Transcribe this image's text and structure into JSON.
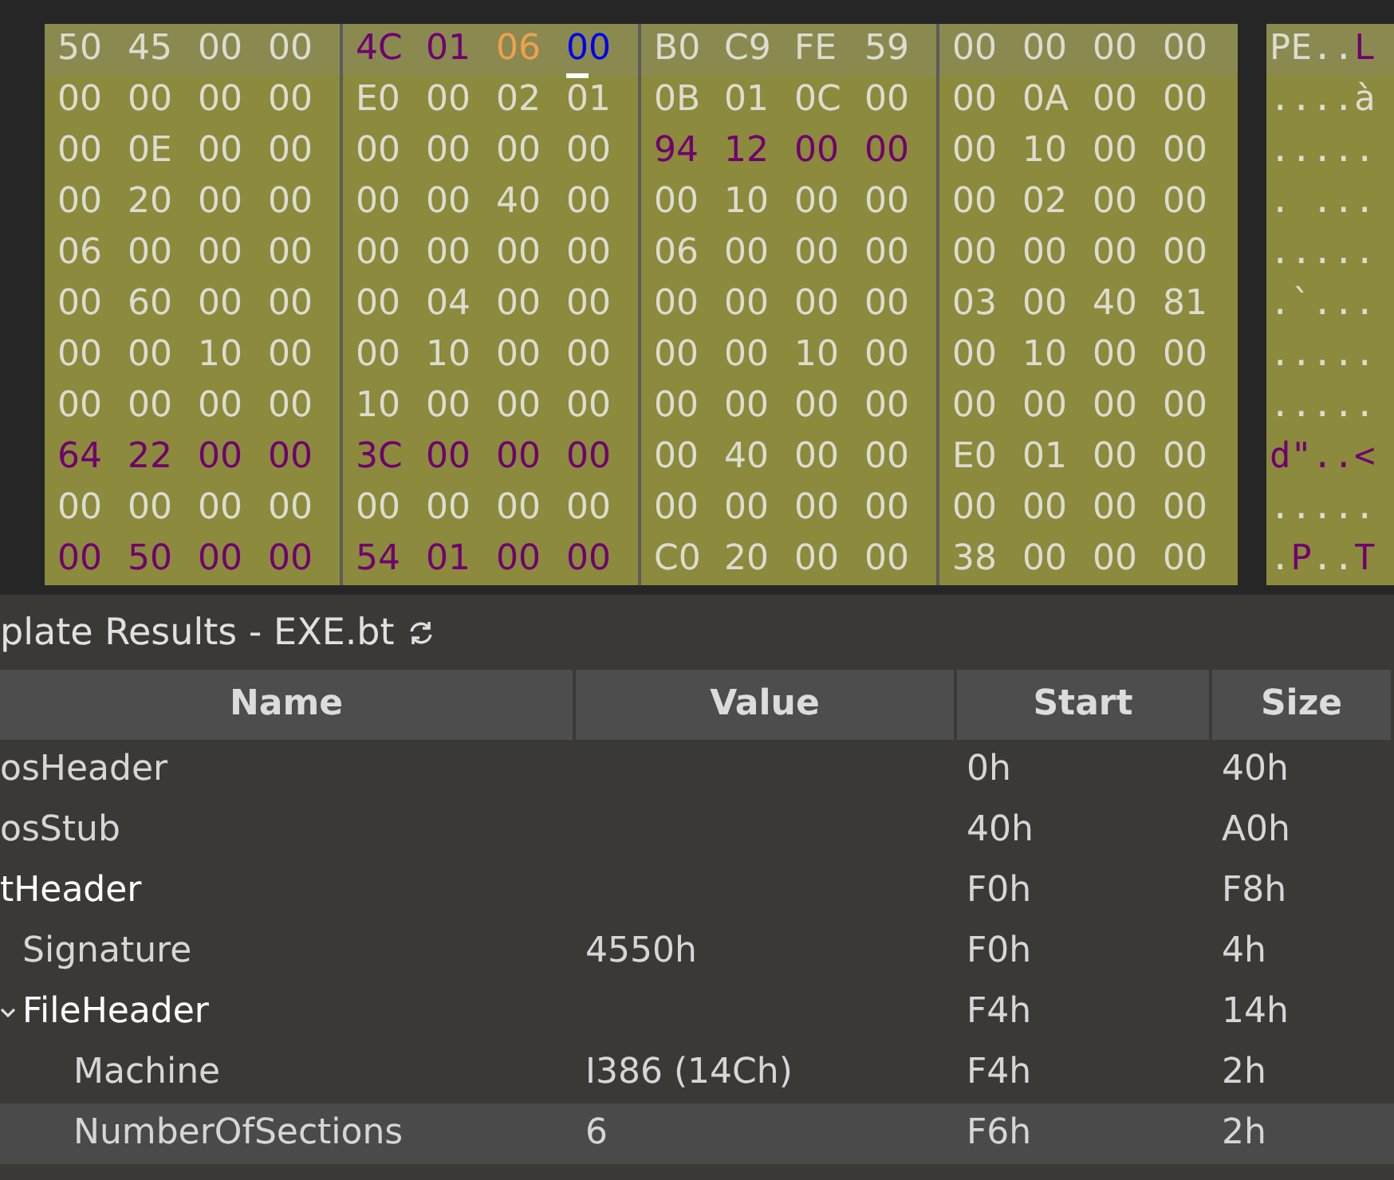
{
  "hex_view": {
    "rows": [
      {
        "selected": true,
        "bytes": [
          "50",
          "45",
          "00",
          "00",
          {
            "text": "4C",
            "color": "#700070"
          },
          {
            "text": "01",
            "color": "#700070"
          },
          {
            "text": "06",
            "color": "#f0a050"
          },
          {
            "text": "00",
            "color": "#0000ee",
            "cursor": true
          },
          "B0",
          "C9",
          "FE",
          "59",
          "00",
          "00",
          "00",
          "00"
        ],
        "ascii": [
          {
            "text": "PE.."
          },
          {
            "text": "L",
            "color": "#700070"
          }
        ]
      },
      {
        "selected": false,
        "bytes": [
          "00",
          "00",
          "00",
          "00",
          "E0",
          "00",
          "02",
          "01",
          "0B",
          "01",
          "0C",
          "00",
          "00",
          "0A",
          "00",
          "00"
        ],
        "ascii": [
          {
            "text": "....à"
          }
        ]
      },
      {
        "selected": false,
        "bytes": [
          "00",
          "0E",
          "00",
          "00",
          "00",
          "00",
          "00",
          "00",
          {
            "text": "94",
            "color": "#700070"
          },
          {
            "text": "12",
            "color": "#700070"
          },
          {
            "text": "00",
            "color": "#700070"
          },
          {
            "text": "00",
            "color": "#700070"
          },
          "00",
          "10",
          "00",
          "00"
        ],
        "ascii": [
          {
            "text": "....."
          }
        ]
      },
      {
        "selected": false,
        "bytes": [
          "00",
          "20",
          "00",
          "00",
          "00",
          "00",
          "40",
          "00",
          "00",
          "10",
          "00",
          "00",
          "00",
          "02",
          "00",
          "00"
        ],
        "ascii": [
          {
            "text": ". ..."
          }
        ]
      },
      {
        "selected": false,
        "bytes": [
          "06",
          "00",
          "00",
          "00",
          "00",
          "00",
          "00",
          "00",
          "06",
          "00",
          "00",
          "00",
          "00",
          "00",
          "00",
          "00"
        ],
        "ascii": [
          {
            "text": "....."
          }
        ]
      },
      {
        "selected": false,
        "bytes": [
          "00",
          "60",
          "00",
          "00",
          "00",
          "04",
          "00",
          "00",
          "00",
          "00",
          "00",
          "00",
          "03",
          "00",
          "40",
          "81"
        ],
        "ascii": [
          {
            "text": ".`..."
          }
        ]
      },
      {
        "selected": false,
        "bytes": [
          "00",
          "00",
          "10",
          "00",
          "00",
          "10",
          "00",
          "00",
          "00",
          "00",
          "10",
          "00",
          "00",
          "10",
          "00",
          "00"
        ],
        "ascii": [
          {
            "text": "....."
          }
        ]
      },
      {
        "selected": false,
        "bytes": [
          "00",
          "00",
          "00",
          "00",
          "10",
          "00",
          "00",
          "00",
          "00",
          "00",
          "00",
          "00",
          "00",
          "00",
          "00",
          "00"
        ],
        "ascii": [
          {
            "text": "....."
          }
        ]
      },
      {
        "selected": false,
        "bytes": [
          {
            "text": "64",
            "color": "#700070"
          },
          {
            "text": "22",
            "color": "#700070"
          },
          {
            "text": "00",
            "color": "#700070"
          },
          {
            "text": "00",
            "color": "#700070"
          },
          {
            "text": "3C",
            "color": "#700070"
          },
          {
            "text": "00",
            "color": "#700070"
          },
          {
            "text": "00",
            "color": "#700070"
          },
          {
            "text": "00",
            "color": "#700070"
          },
          "00",
          "40",
          "00",
          "00",
          "E0",
          "01",
          "00",
          "00"
        ],
        "ascii": [
          {
            "text": "d\"..<",
            "color": "#700070"
          }
        ]
      },
      {
        "selected": false,
        "bytes": [
          "00",
          "00",
          "00",
          "00",
          "00",
          "00",
          "00",
          "00",
          "00",
          "00",
          "00",
          "00",
          "00",
          "00",
          "00",
          "00"
        ],
        "ascii": [
          {
            "text": "....."
          }
        ]
      },
      {
        "selected": false,
        "bytes": [
          {
            "text": "00",
            "color": "#700070"
          },
          {
            "text": "50",
            "color": "#700070"
          },
          {
            "text": "00",
            "color": "#700070"
          },
          {
            "text": "00",
            "color": "#700070"
          },
          {
            "text": "54",
            "color": "#700070"
          },
          {
            "text": "01",
            "color": "#700070"
          },
          {
            "text": "00",
            "color": "#700070"
          },
          {
            "text": "00",
            "color": "#700070"
          },
          "C0",
          "20",
          "00",
          "00",
          "38",
          "00",
          "00",
          "00"
        ],
        "ascii": [
          {
            "text": "."
          },
          {
            "text": "P",
            "color": "#700070"
          },
          {
            "text": ".."
          },
          {
            "text": "T",
            "color": "#700070"
          }
        ]
      }
    ]
  },
  "template_results": {
    "title": "plate Results - EXE.bt",
    "columns": [
      "Name",
      "Value",
      "Start",
      "Size"
    ],
    "rows": [
      {
        "name": "osHeader",
        "start": "0h",
        "size": "40h",
        "expanded": false,
        "selected": false
      },
      {
        "name": "osStub",
        "start": "40h",
        "size": "A0h",
        "expanded": false,
        "selected": false
      },
      {
        "name": "tHeader",
        "start": "F0h",
        "size": "F8h",
        "expanded": true,
        "selected": false,
        "children": [
          {
            "name": "Signature",
            "value": "4550h",
            "start": "F0h",
            "size": "4h",
            "expanded": false,
            "selected": false
          },
          {
            "name": "FileHeader",
            "start": "F4h",
            "size": "14h",
            "expanded": true,
            "selected": false,
            "children": [
              {
                "name": "Machine",
                "value": "I386 (14Ch)",
                "start": "F4h",
                "size": "2h",
                "expanded": false,
                "selected": false
              },
              {
                "name": "NumberOfSections",
                "value": "6",
                "start": "F6h",
                "size": "2h",
                "expanded": false,
                "selected": true
              }
            ]
          }
        ]
      }
    ]
  }
}
